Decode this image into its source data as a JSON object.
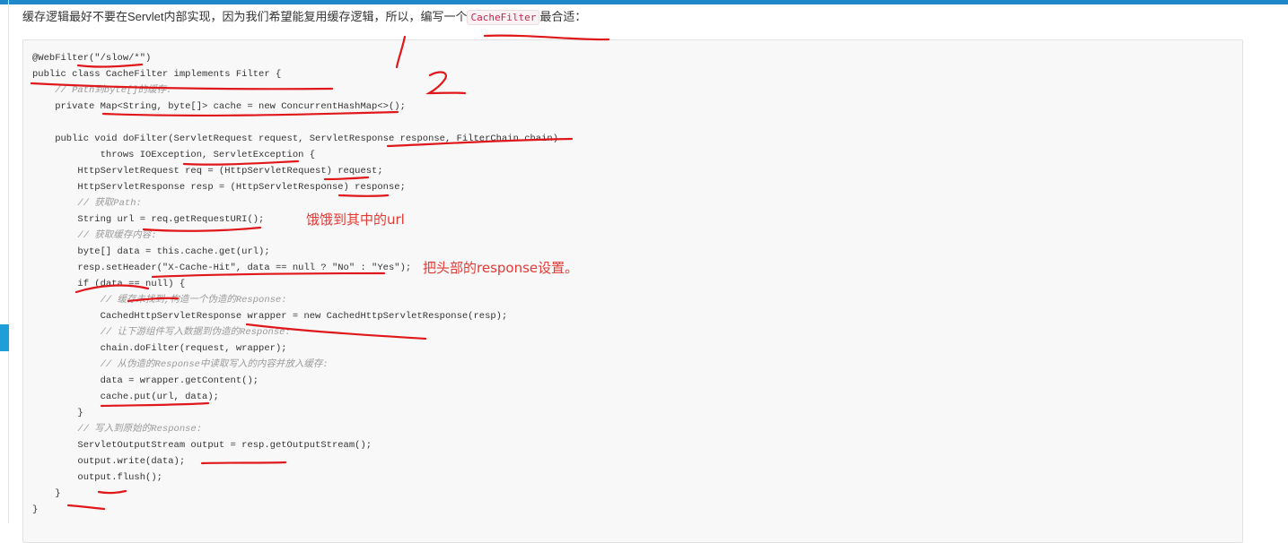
{
  "intro": {
    "before": "缓存逻辑最好不要在Servlet内部实现，因为我们希望能复用缓存逻辑，所以，编写一个",
    "code": "CacheFilter",
    "after": "最合适："
  },
  "code_lines": [
    "@WebFilter(\"/slow/*\")",
    "public class CacheFilter implements Filter {",
    "    // Path到byte[]的缓存:",
    "    private Map<String, byte[]> cache = new ConcurrentHashMap<>();",
    "",
    "    public void doFilter(ServletRequest request, ServletResponse response, FilterChain chain)",
    "            throws IOException, ServletException {",
    "        HttpServletRequest req = (HttpServletRequest) request;",
    "        HttpServletResponse resp = (HttpServletResponse) response;",
    "        // 获取Path:",
    "        String url = req.getRequestURI();",
    "        // 获取缓存内容:",
    "        byte[] data = this.cache.get(url);",
    "        resp.setHeader(\"X-Cache-Hit\", data == null ? \"No\" : \"Yes\");",
    "        if (data == null) {",
    "            // 缓存未找到,构造一个伪造的Response:",
    "            CachedHttpServletResponse wrapper = new CachedHttpServletResponse(resp);",
    "            // 让下游组件写入数据到伪造的Response:",
    "            chain.doFilter(request, wrapper);",
    "            // 从伪造的Response中读取写入的内容并放入缓存:",
    "            data = wrapper.getContent();",
    "            cache.put(url, data);",
    "        }",
    "        // 写入到原始的Response:",
    "        ServletOutputStream output = resp.getOutputStream();",
    "        output.write(data);",
    "        output.flush();",
    "    }",
    "}"
  ],
  "notes": {
    "n1": "饿饿到其中的url",
    "n2": "把头部的response设置。",
    "n3": "2"
  },
  "colors": {
    "accent": "#1e88c8",
    "annotation": "#e53935"
  }
}
